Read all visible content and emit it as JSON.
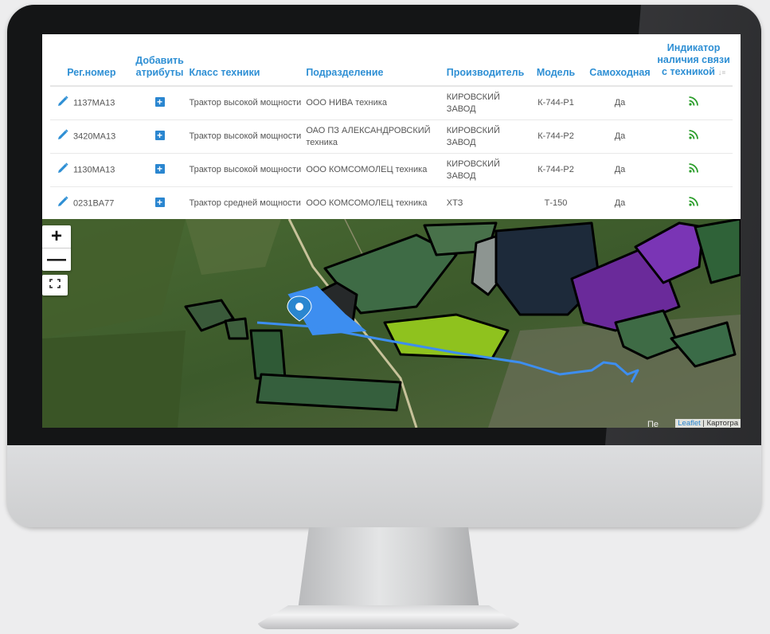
{
  "table": {
    "headers": {
      "reg": "Рег.номер",
      "add_line1": "Добавить",
      "add_line2": "атрибуты",
      "class": "Класс техники",
      "division": "Подразделение",
      "manufacturer": "Производитель",
      "model": "Модель",
      "self_propelled": "Самоходная",
      "indicator_line1": "Индикатор",
      "indicator_line2": "наличия связи",
      "indicator_line3": "с техникой"
    },
    "rows": [
      {
        "reg": "1137MA13",
        "class": "Трактор высокой мощности",
        "division": "ООО НИВА техника",
        "manufacturer": "КИРОВСКИЙ ЗАВОД",
        "model": "К-744-Р1",
        "self_propelled": "Да"
      },
      {
        "reg": "3420MA13",
        "class": "Трактор высокой мощности",
        "division": "ОАО ПЗ АЛЕКСАНДРОВСКИЙ техника",
        "manufacturer": "КИРОВСКИЙ ЗАВОД",
        "model": "К-744-Р2",
        "self_propelled": "Да"
      },
      {
        "reg": "1130MA13",
        "class": "Трактор высокой мощности",
        "division": "ООО КОМСОМОЛЕЦ техника",
        "manufacturer": "КИРОВСКИЙ ЗАВОД",
        "model": "К-744-Р2",
        "self_propelled": "Да"
      },
      {
        "reg": "0231BA77",
        "class": "Трактор средней мощности",
        "division": "ООО КОМСОМОЛЕЦ техника",
        "manufacturer": "ХТЗ",
        "model": "Т-150",
        "self_propelled": "Да"
      }
    ]
  },
  "map": {
    "zoom_in": "+",
    "zoom_out": "—",
    "attribution_link": "Leaflet",
    "attribution_rest": " | Картогра",
    "place_label": "Пе"
  },
  "colors": {
    "accent": "#2e8fd4",
    "plus_button": "#2a86d0",
    "signal": "#2a9d2a",
    "track": "#3d8ef0",
    "field_lime": "#8fc21e",
    "field_purple": "#6a2a9a",
    "field_dark": "#1d2a3a"
  }
}
